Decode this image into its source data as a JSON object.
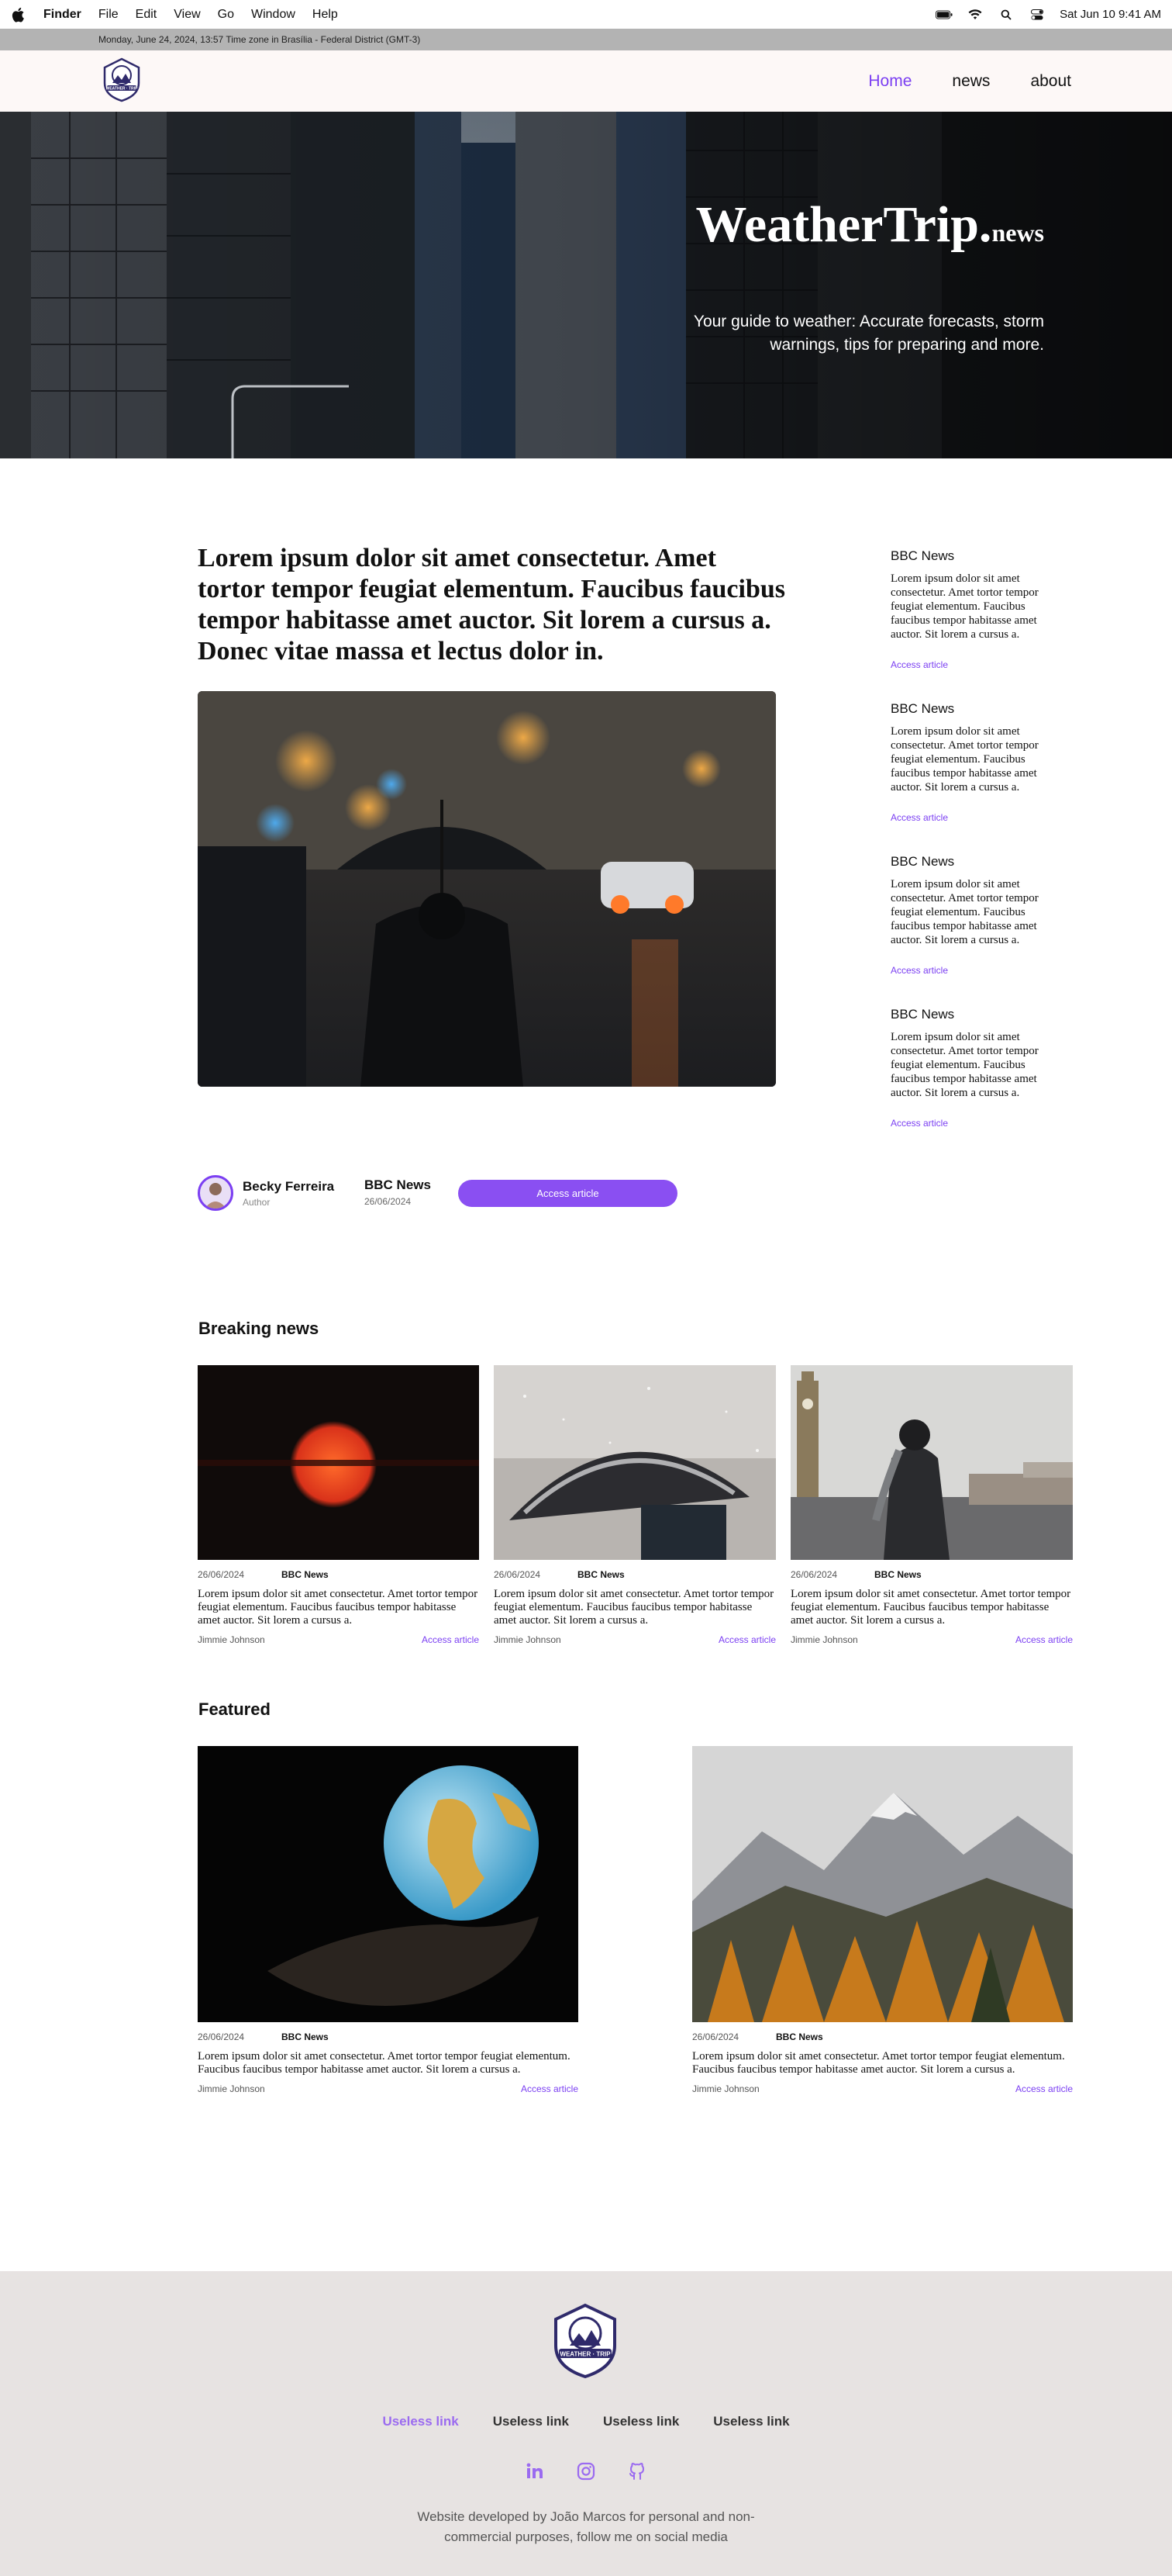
{
  "menubar": {
    "items": [
      "Finder",
      "File",
      "Edit",
      "View",
      "Go",
      "Window",
      "Help"
    ],
    "clock": "Sat Jun 10  9:41 AM"
  },
  "timezone": "Monday, June 24, 2024, 13:57 Time zone in Brasília - Federal District (GMT-3)",
  "nav": {
    "home": "Home",
    "news": "news",
    "about": "about"
  },
  "hero": {
    "title_main": "WeatherTrip.",
    "title_suffix": "news",
    "tagline": "Your guide to weather: Accurate forecasts, storm warnings, tips for preparing and more."
  },
  "main_article": {
    "headline": "Lorem ipsum dolor sit amet consectetur. Amet tortor tempor feugiat elementum. Faucibus faucibus tempor habitasse amet auctor. Sit lorem a cursus a. Donec vitae massa et lectus dolor in.",
    "author_name": "Becky Ferreira",
    "author_role": "Author",
    "source": "BBC News",
    "date": "26/06/2024",
    "button": "Access article"
  },
  "sidebar": [
    {
      "source": "BBC News",
      "text": "Lorem ipsum dolor sit amet consectetur. Amet tortor tempor feugiat elementum. Faucibus faucibus tempor habitasse amet auctor. Sit lorem a cursus a.",
      "link": "Access article"
    },
    {
      "source": "BBC News",
      "text": "Lorem ipsum dolor sit amet consectetur. Amet tortor tempor feugiat elementum. Faucibus faucibus tempor habitasse amet auctor. Sit lorem a cursus a.",
      "link": "Access article"
    },
    {
      "source": "BBC News",
      "text": "Lorem ipsum dolor sit amet consectetur. Amet tortor tempor feugiat elementum. Faucibus faucibus tempor habitasse amet auctor. Sit lorem a cursus a.",
      "link": "Access article"
    },
    {
      "source": "BBC News",
      "text": "Lorem ipsum dolor sit amet consectetur. Amet tortor tempor feugiat elementum. Faucibus faucibus tempor habitasse amet auctor. Sit lorem a cursus a.",
      "link": "Access article"
    }
  ],
  "breaking": {
    "title": "Breaking news",
    "cards": [
      {
        "date": "26/06/2024",
        "source": "BBC News",
        "text": "Lorem ipsum dolor sit amet consectetur. Amet tortor tempor feugiat elementum. Faucibus faucibus tempor habitasse amet auctor. Sit lorem a cursus a.",
        "author": "Jimmie Johnson",
        "link": "Access article"
      },
      {
        "date": "26/06/2024",
        "source": "BBC News",
        "text": "Lorem ipsum dolor sit amet consectetur. Amet tortor tempor feugiat elementum. Faucibus faucibus tempor habitasse amet auctor. Sit lorem a cursus a.",
        "author": "Jimmie Johnson",
        "link": "Access article"
      },
      {
        "date": "26/06/2024",
        "source": "BBC News",
        "text": "Lorem ipsum dolor sit amet consectetur. Amet tortor tempor feugiat elementum. Faucibus faucibus tempor habitasse amet auctor. Sit lorem a cursus a.",
        "author": "Jimmie Johnson",
        "link": "Access article"
      }
    ]
  },
  "featured": {
    "title": "Featured",
    "cards": [
      {
        "date": "26/06/2024",
        "source": "BBC News",
        "text": "Lorem ipsum dolor sit amet consectetur. Amet tortor tempor feugiat elementum. Faucibus faucibus tempor habitasse amet auctor. Sit lorem a cursus a.",
        "author": "Jimmie Johnson",
        "link": "Access article"
      },
      {
        "date": "26/06/2024",
        "source": "BBC News",
        "text": "Lorem ipsum dolor sit amet consectetur. Amet tortor tempor feugiat elementum. Faucibus faucibus tempor habitasse amet auctor. Sit lorem a cursus a.",
        "author": "Jimmie Johnson",
        "link": "Access article"
      }
    ]
  },
  "footer": {
    "logo_text": "WEATHER · TRIP",
    "links": [
      "Useless link",
      "Useless link",
      "Useless link",
      "Useless link"
    ],
    "social": [
      "linkedin-icon",
      "instagram-icon",
      "github-icon"
    ],
    "credit": "Website developed by João Marcos for personal and non-commercial purposes, follow me on social media"
  },
  "colors": {
    "accent": "#7b3ff2",
    "button": "#8a4ff2",
    "footer_bg": "#e7e3e2",
    "header_bg": "#fdf8f7"
  }
}
